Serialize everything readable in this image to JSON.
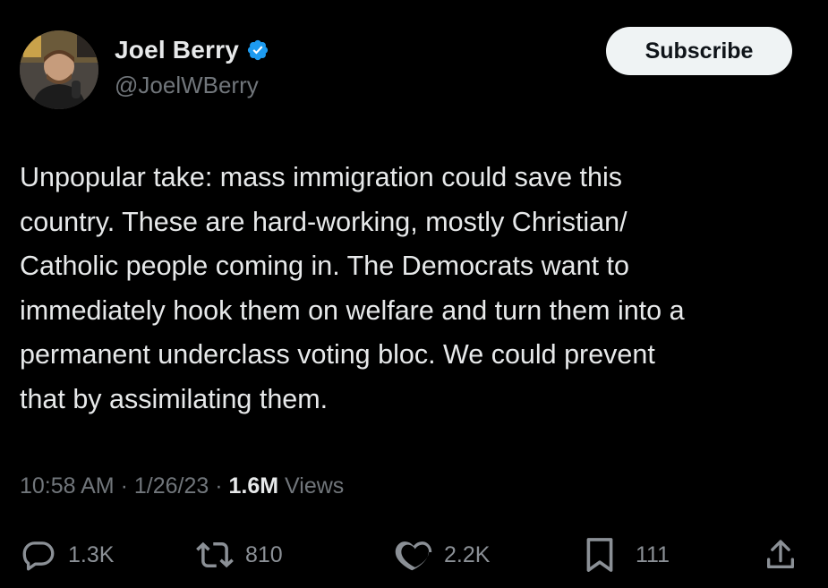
{
  "author": {
    "display_name": "Joel Berry",
    "handle": "@JoelWBerry",
    "verified": true,
    "avatar": "avatar-photo"
  },
  "subscribe_label": "Subscribe",
  "tweet": {
    "lines": [
      "Unpopular take: mass immigration could save this",
      "country. These are hard-working, mostly Christian/",
      "Catholic people coming in. The Democrats want to",
      "immediately hook them on welfare and turn them into a",
      "permanent underclass voting bloc. We could prevent",
      "that by assimilating them."
    ]
  },
  "meta": {
    "time": "10:58 AM",
    "sep1": " · ",
    "date": "1/26/23",
    "sep2": " · ",
    "views_count": "1.6M",
    "views_label": " Views"
  },
  "actions": {
    "replies": {
      "icon": "reply-icon",
      "count": "1.3K"
    },
    "reposts": {
      "icon": "repost-icon",
      "count": "810"
    },
    "likes": {
      "icon": "heart-icon",
      "count": "2.2K"
    },
    "bookmarks": {
      "icon": "bookmark-icon",
      "count": "111"
    },
    "share": {
      "icon": "share-icon"
    }
  },
  "colors": {
    "background": "#000000",
    "text_primary": "#e7e9ea",
    "text_secondary": "#71767b",
    "verified_badge": "#1d9bf0",
    "subscribe_bg": "#eff3f4"
  }
}
